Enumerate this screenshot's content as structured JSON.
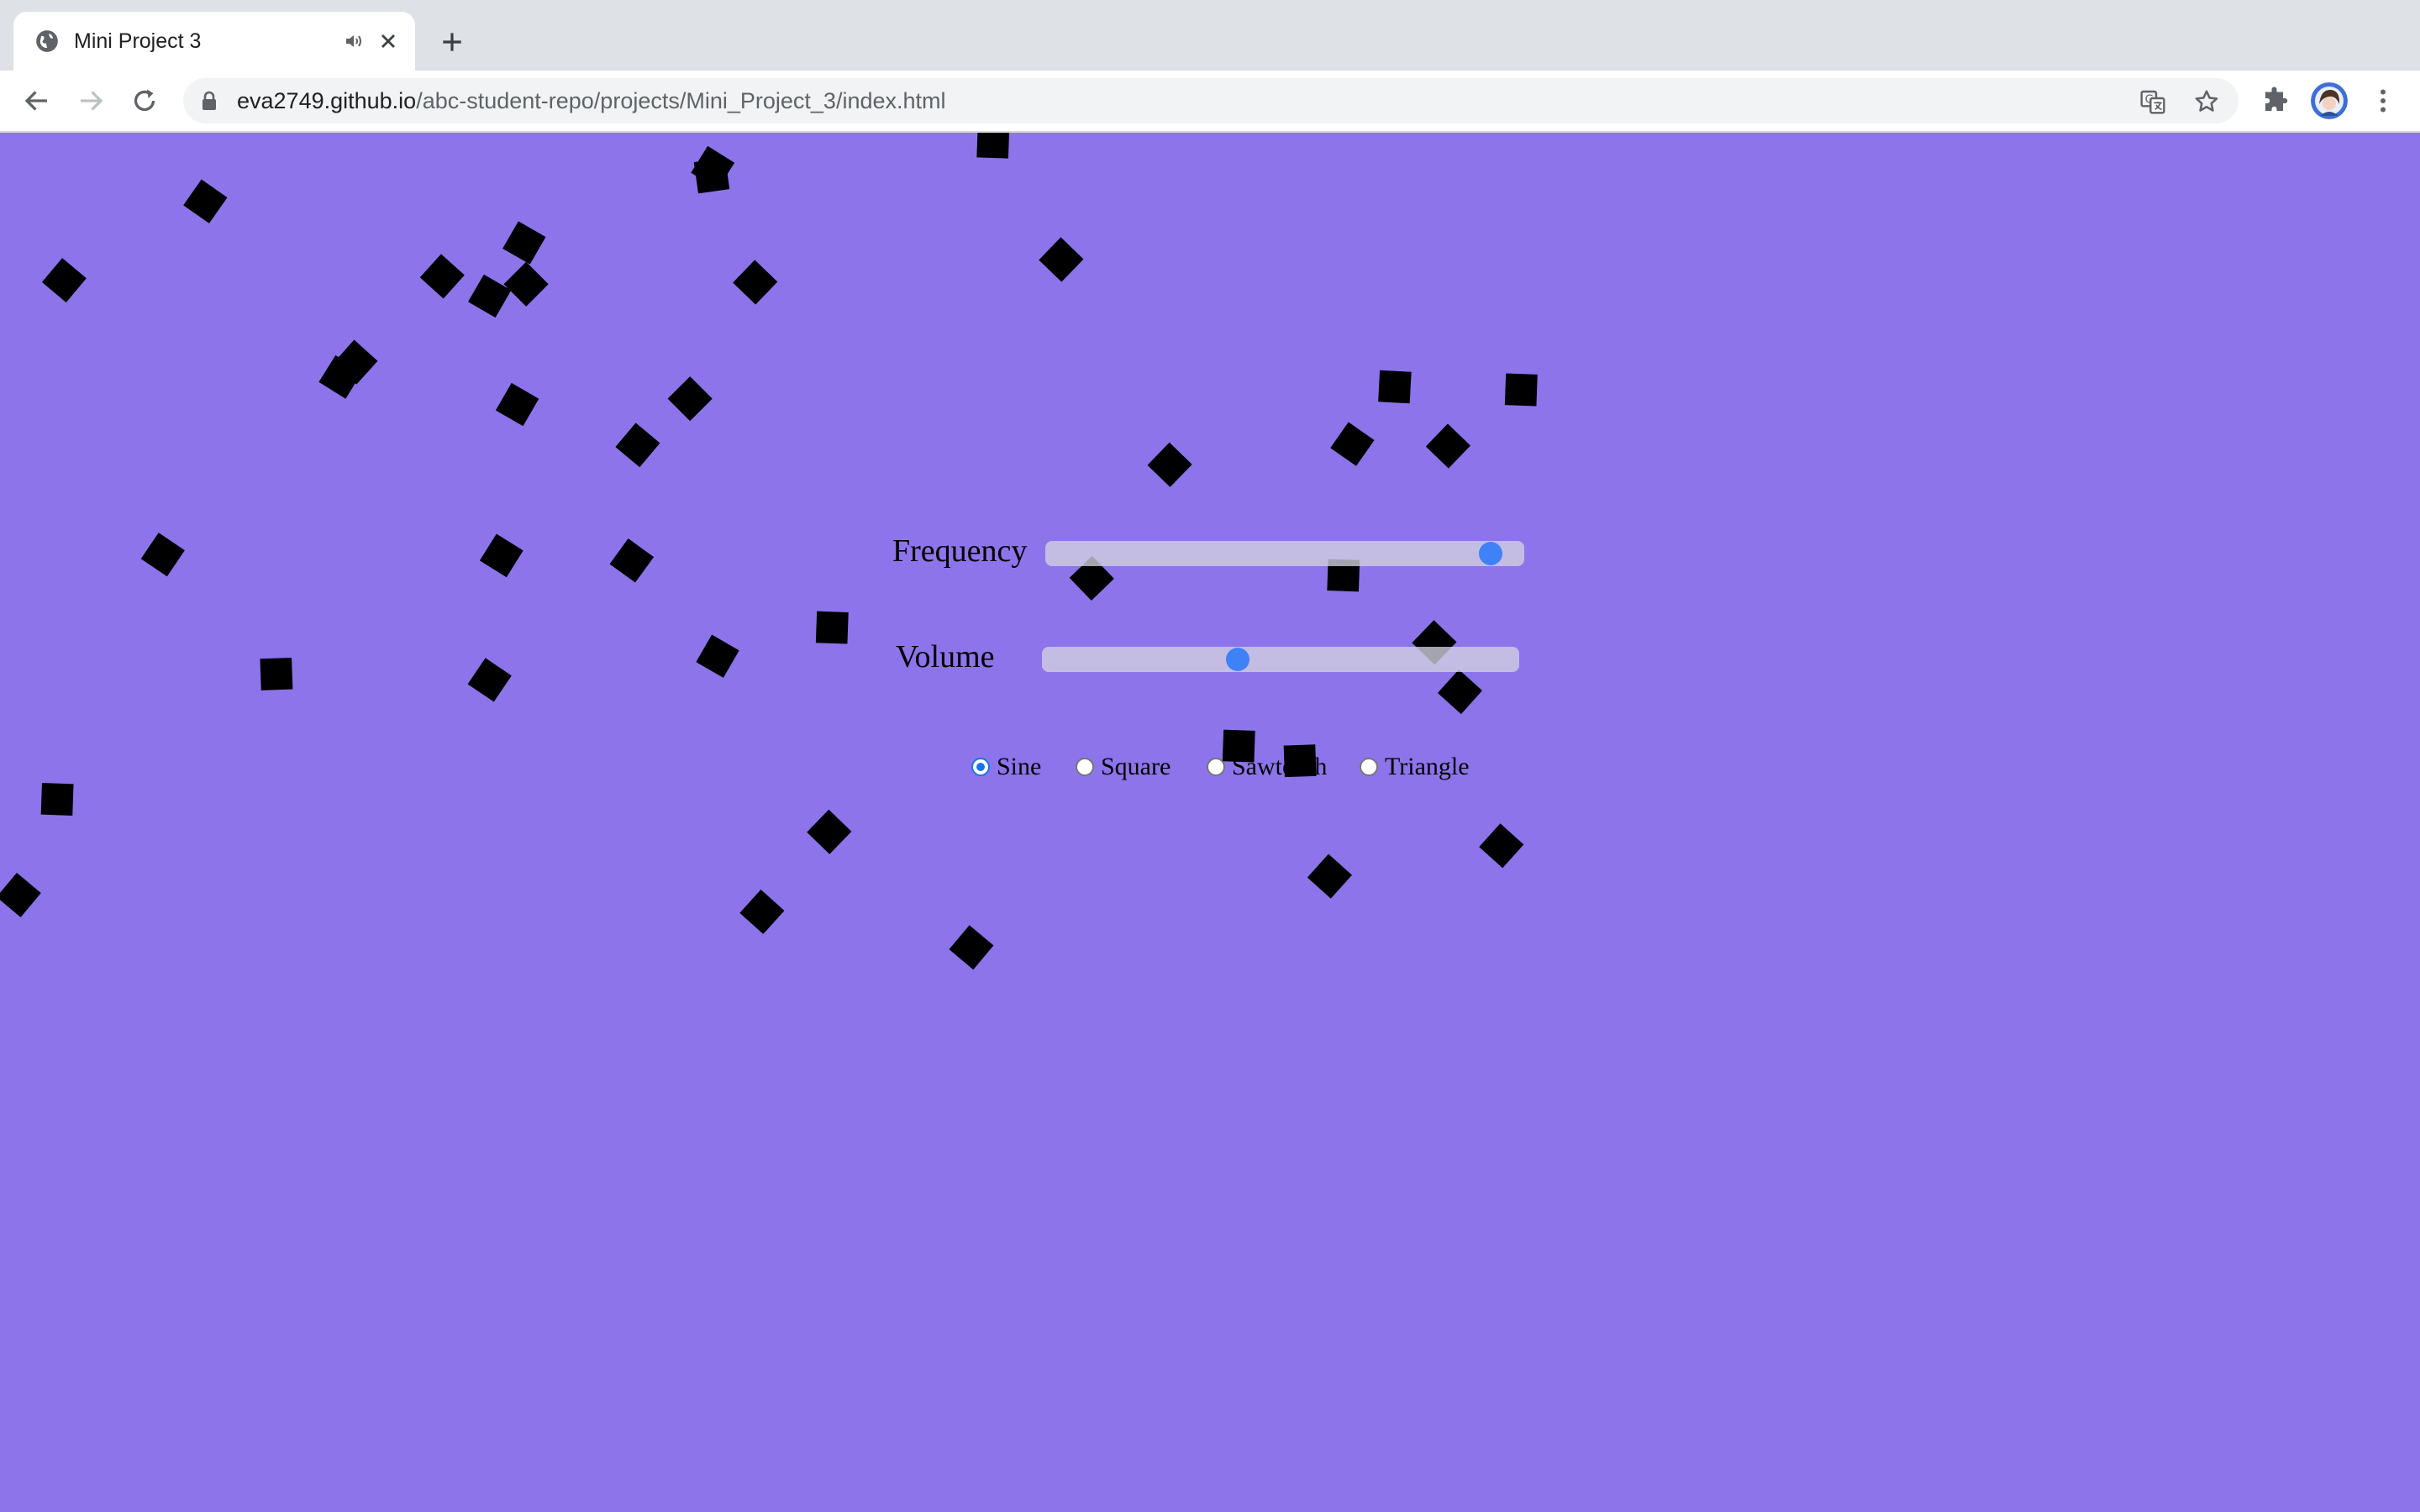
{
  "browser": {
    "tab": {
      "title": "Mini Project 3"
    },
    "address_bar": {
      "host": "eva2749.github.io",
      "path": "/abc-student-repo/projects/Mini_Project_3/index.html"
    }
  },
  "controls": {
    "frequency": {
      "label": "Frequency",
      "value_fraction": 0.93
    },
    "volume": {
      "label": "Volume",
      "value_fraction": 0.41
    },
    "waveform": {
      "selected": "Sine",
      "options": [
        {
          "label": "Sine",
          "checked": true
        },
        {
          "label": "Square",
          "checked": false
        },
        {
          "label": "Sawtooth",
          "checked": false
        },
        {
          "label": "Triangle",
          "checked": false
        }
      ]
    }
  },
  "colors": {
    "background": "#8e74ea",
    "square": "#000000",
    "slider_thumb": "#3f82f8"
  },
  "icons": [
    "globe-icon",
    "audio-icon",
    "close-icon",
    "plus-icon",
    "back-icon",
    "forward-icon",
    "reload-icon",
    "lock-icon",
    "translate-icon",
    "star-icon",
    "extensions-icon",
    "menu-icon"
  ]
}
